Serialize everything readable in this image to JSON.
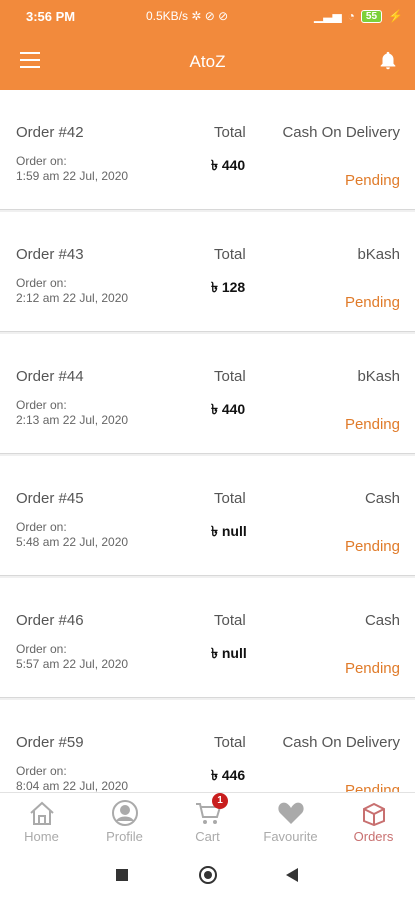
{
  "status_bar": {
    "time": "3:56 PM",
    "speed": "0.5KB/s",
    "battery": "55"
  },
  "app_bar": {
    "title": "AtoZ"
  },
  "orders": [
    {
      "id": "Order #42",
      "total_label": "Total",
      "method": "Cash On Delivery",
      "order_on_label": "Order on:",
      "date": "1:59 am 22 Jul, 2020",
      "amount": "৳ 440",
      "status": "Pending"
    },
    {
      "id": "Order #43",
      "total_label": "Total",
      "method": "bKash",
      "order_on_label": "Order on:",
      "date": "2:12 am 22 Jul, 2020",
      "amount": "৳ 128",
      "status": "Pending"
    },
    {
      "id": "Order #44",
      "total_label": "Total",
      "method": "bKash",
      "order_on_label": "Order on:",
      "date": "2:13 am 22 Jul, 2020",
      "amount": "৳ 440",
      "status": "Pending"
    },
    {
      "id": "Order #45",
      "total_label": "Total",
      "method": "Cash",
      "order_on_label": "Order on:",
      "date": "5:48 am 22 Jul, 2020",
      "amount": "৳ null",
      "status": "Pending"
    },
    {
      "id": "Order #46",
      "total_label": "Total",
      "method": "Cash",
      "order_on_label": "Order on:",
      "date": "5:57 am 22 Jul, 2020",
      "amount": "৳ null",
      "status": "Pending"
    },
    {
      "id": "Order #59",
      "total_label": "Total",
      "method": "Cash On Delivery",
      "order_on_label": "Order on:",
      "date": "8:04 am 22 Jul, 2020",
      "amount": "৳ 446",
      "status": "Pending"
    }
  ],
  "bottom_nav": [
    {
      "label": "Home",
      "icon": "home-icon"
    },
    {
      "label": "Profile",
      "icon": "profile-icon"
    },
    {
      "label": "Cart",
      "icon": "cart-icon",
      "badge": "1"
    },
    {
      "label": "Favourite",
      "icon": "heart-icon"
    },
    {
      "label": "Orders",
      "icon": "orders-icon",
      "active": true
    }
  ],
  "colors": {
    "primary": "#f28a3c",
    "pending": "#e07b2a",
    "active_nav": "#c87070",
    "badge": "#c81e1e"
  }
}
